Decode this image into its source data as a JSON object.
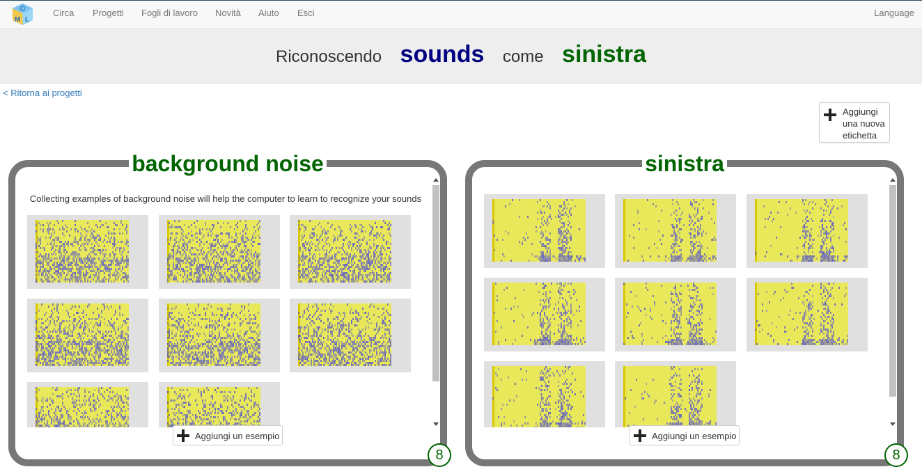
{
  "navbar": {
    "items": [
      "Circa",
      "Progetti",
      "Fogli di lavoro",
      "Novità",
      "Aiuto",
      "Esci"
    ],
    "language": "Language",
    "logo_icon": "ml4k-cube-logo-icon"
  },
  "title": {
    "prefix": "Riconoscendo",
    "project_type": "sounds",
    "middle": "come",
    "label": "sinistra"
  },
  "back_link": "< Ritorna ai progetti",
  "add_label_button": "Aggiungi una nuova etichetta",
  "colors": {
    "project_type": "#000080",
    "label": "#006400",
    "panel_border": "#777777",
    "spectrogram_base": "#e8e85a",
    "spectrogram_energy": "#4a4ad8"
  },
  "labels": [
    {
      "name": "background noise",
      "hint": "Collecting examples of background noise will help the computer to learn to recognize your sounds",
      "add_example": "Aggiungi un esempio",
      "count": "8",
      "examples": [
        "noise",
        "noise",
        "noise",
        "noise",
        "noise",
        "noise",
        "noise",
        "noise"
      ]
    },
    {
      "name": "sinistra",
      "hint": "",
      "add_example": "Aggiungi un esempio",
      "count": "8",
      "examples": [
        "word",
        "word",
        "word",
        "word",
        "word",
        "word",
        "word",
        "word"
      ]
    }
  ]
}
